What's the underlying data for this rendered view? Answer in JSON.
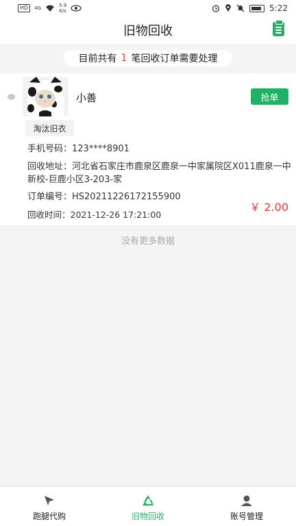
{
  "status_bar": {
    "hd": "HD",
    "network": "4G",
    "speed": "5.9",
    "speed_unit": "K/s",
    "time": "5:22"
  },
  "header": {
    "title": "旧物回收"
  },
  "notice": {
    "prefix": "目前共有",
    "count": "1",
    "suffix": "笔回收订单需要处理"
  },
  "order": {
    "username": "小善",
    "grab_label": "抢单",
    "tag": "淘汰旧衣",
    "phone": "手机号码：123****8901",
    "address": "回收地址：河北省石家庄市鹿泉区鹿泉一中家属院区X011鹿泉一中新校-巨鹿小区3-203-家",
    "order_no": "订单编号：HS20211226172155900",
    "time": "回收时间：2021-12-26 17:21:00",
    "price": "￥ 2.00"
  },
  "list_end": "没有更多数据",
  "bottom_nav": [
    {
      "label": "跑腿代购",
      "icon": "send-icon"
    },
    {
      "label": "旧物回收",
      "icon": "recycle-icon"
    },
    {
      "label": "账号管理",
      "icon": "user-icon"
    }
  ],
  "colors": {
    "accent": "#1fb266",
    "price": "#d63a2a",
    "count": "#e03a2f"
  }
}
